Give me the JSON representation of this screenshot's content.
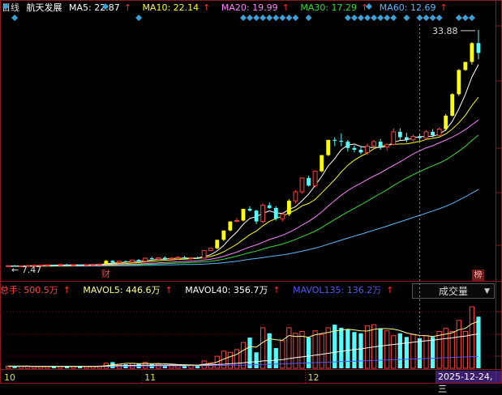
{
  "header": {
    "period": "日线",
    "stock_name": "航天发展",
    "ma": [
      {
        "label": "MA5: 22.87",
        "color": "#ffffff"
      },
      {
        "label": "MA10: 22.14",
        "color": "#ffff00"
      },
      {
        "label": "MA20: 19.99",
        "color": "#ff80ff"
      },
      {
        "label": "MA30: 17.29",
        "color": "#33dd33"
      },
      {
        "label": "MA60: 12.69",
        "color": "#55bbff"
      }
    ],
    "arrow": "↑"
  },
  "volume_header": {
    "total": {
      "label": "总手: 500.5万",
      "color": "#ff4444"
    },
    "mavol": [
      {
        "label": "MAVOL5: 446.6万",
        "color": "#ffff88"
      },
      {
        "label": "MAVOL40: 356.7万",
        "color": "#ffffff"
      },
      {
        "label": "MAVOL135: 136.2万",
        "color": "#5555ff"
      }
    ],
    "arrow": "↑"
  },
  "indicator_select": {
    "value": "成交量"
  },
  "date_badge": "2025-12-24,三",
  "badge_bang": "榜",
  "badge_cai": "财",
  "colors": {
    "up": "#ff4040",
    "down": "#54ffff",
    "limit_up": "#ffff00",
    "diamond": "#3aa0d8"
  },
  "chart_data": {
    "type": "candlestick",
    "price_range": [
      6.5,
      34.5
    ],
    "annotations": {
      "high_label": "33.88",
      "low_label": "7.47"
    },
    "x_axis_labels": [
      {
        "label": "10",
        "index": 0
      },
      {
        "label": "11",
        "index": 21
      },
      {
        "label": "12",
        "index": 46
      }
    ],
    "candles": [
      [
        7.5,
        7.62,
        7.47,
        7.56
      ],
      [
        7.56,
        7.64,
        7.5,
        7.53
      ],
      [
        7.53,
        7.6,
        7.48,
        7.55
      ],
      [
        7.55,
        7.62,
        7.5,
        7.58
      ],
      [
        7.58,
        7.66,
        7.52,
        7.6
      ],
      [
        7.6,
        7.68,
        7.55,
        7.62
      ],
      [
        7.62,
        7.7,
        7.56,
        7.65
      ],
      [
        7.65,
        7.7,
        7.58,
        7.6
      ],
      [
        7.6,
        7.75,
        7.57,
        7.7
      ],
      [
        7.7,
        7.75,
        7.6,
        7.62
      ],
      [
        7.62,
        7.7,
        7.58,
        7.66
      ],
      [
        7.66,
        7.72,
        7.6,
        7.64
      ],
      [
        7.64,
        7.72,
        7.6,
        7.68
      ],
      [
        7.68,
        7.75,
        7.62,
        7.7
      ],
      [
        7.7,
        7.8,
        7.65,
        7.74
      ],
      [
        7.74,
        8.2,
        7.7,
        8.1
      ],
      [
        8.1,
        8.2,
        7.8,
        7.9
      ],
      [
        7.9,
        8.1,
        7.85,
        8.05
      ],
      [
        8.05,
        8.15,
        7.9,
        7.95
      ],
      [
        7.95,
        8.25,
        7.9,
        8.2
      ],
      [
        8.2,
        8.3,
        8.0,
        8.05
      ],
      [
        8.05,
        8.5,
        8.0,
        8.4
      ],
      [
        8.4,
        8.55,
        8.15,
        8.3
      ],
      [
        8.3,
        8.5,
        8.2,
        8.45
      ],
      [
        8.45,
        8.6,
        8.2,
        8.3
      ],
      [
        8.3,
        8.5,
        8.1,
        8.4
      ],
      [
        8.4,
        8.6,
        8.2,
        8.5
      ],
      [
        8.5,
        8.65,
        8.25,
        8.35
      ],
      [
        8.35,
        8.5,
        8.2,
        8.45
      ],
      [
        8.45,
        8.6,
        8.3,
        8.4
      ],
      [
        8.4,
        9.3,
        8.35,
        9.24
      ],
      [
        9.24,
        9.6,
        9.2,
        9.5
      ],
      [
        9.5,
        10.45,
        9.4,
        10.45
      ],
      [
        10.45,
        11.5,
        10.3,
        11.49
      ],
      [
        11.49,
        12.5,
        11.4,
        12.5
      ],
      [
        12.5,
        12.9,
        12.4,
        12.6
      ],
      [
        12.6,
        13.92,
        12.5,
        13.9
      ],
      [
        13.9,
        14.2,
        13.6,
        13.7
      ],
      [
        13.7,
        13.8,
        12.2,
        12.5
      ],
      [
        12.5,
        14.5,
        12.3,
        14.3
      ],
      [
        14.3,
        14.6,
        13.9,
        14.0
      ],
      [
        14.0,
        14.2,
        12.6,
        12.8
      ],
      [
        12.8,
        13.5,
        12.5,
        13.3
      ],
      [
        13.3,
        15.0,
        13.1,
        14.8
      ],
      [
        14.8,
        16.0,
        14.5,
        15.8
      ],
      [
        15.8,
        17.4,
        15.6,
        17.35
      ],
      [
        17.35,
        17.6,
        16.4,
        16.5
      ],
      [
        16.5,
        18.2,
        16.3,
        18.1
      ],
      [
        18.1,
        19.9,
        18.0,
        19.9
      ],
      [
        19.9,
        21.6,
        19.8,
        21.6
      ],
      [
        21.6,
        21.9,
        20.9,
        21.5
      ],
      [
        21.5,
        22.3,
        20.9,
        21.4
      ],
      [
        21.4,
        21.6,
        20.3,
        20.7
      ],
      [
        20.7,
        21.0,
        20.2,
        20.5
      ],
      [
        20.5,
        20.9,
        20.0,
        20.2
      ],
      [
        20.2,
        21.2,
        19.9,
        20.9
      ],
      [
        20.9,
        21.6,
        20.6,
        21.4
      ],
      [
        21.4,
        21.7,
        20.5,
        20.8
      ],
      [
        20.8,
        21.2,
        20.4,
        21.1
      ],
      [
        21.1,
        22.9,
        21.0,
        22.5
      ],
      [
        22.5,
        22.9,
        21.6,
        21.9
      ],
      [
        21.9,
        22.4,
        21.3,
        21.6
      ],
      [
        21.6,
        22.2,
        21.4,
        22.0
      ],
      [
        22.0,
        22.3,
        21.5,
        21.8
      ],
      [
        21.8,
        22.7,
        21.6,
        22.5
      ],
      [
        22.5,
        22.8,
        21.9,
        22.1
      ],
      [
        22.1,
        23.0,
        22.0,
        22.8
      ],
      [
        22.8,
        24.5,
        22.6,
        24.3
      ],
      [
        24.3,
        26.8,
        24.2,
        26.7
      ],
      [
        26.7,
        29.5,
        26.5,
        29.4
      ],
      [
        29.4,
        30.3,
        29.3,
        30.3
      ],
      [
        30.3,
        32.5,
        30.0,
        32.4
      ],
      [
        32.4,
        33.88,
        30.6,
        31.3
      ]
    ],
    "limit_up_days": [
      15,
      32,
      33,
      34,
      36,
      43,
      48,
      49,
      67,
      68,
      69,
      70,
      71
    ],
    "volume_range": [
      0,
      560
    ],
    "volume": [
      18,
      17,
      16,
      18,
      16,
      15,
      16,
      15,
      17,
      15,
      16,
      15,
      16,
      15,
      18,
      42,
      50,
      34,
      32,
      40,
      38,
      48,
      34,
      35,
      26,
      28,
      25,
      29,
      27,
      24,
      60,
      45,
      98,
      140,
      130,
      152,
      210,
      250,
      130,
      330,
      285,
      165,
      225,
      330,
      285,
      300,
      250,
      305,
      275,
      330,
      355,
      330,
      315,
      295,
      285,
      345,
      355,
      325,
      305,
      265,
      285,
      255,
      275,
      245,
      265,
      255,
      300,
      325,
      300,
      390,
      300,
      500,
      420
    ],
    "mavol5": [
      17,
      17,
      17,
      17,
      16,
      16,
      16,
      16,
      16,
      16,
      16,
      16,
      16,
      16,
      16,
      22,
      28,
      32,
      40,
      40,
      38,
      39,
      38,
      39,
      36,
      34,
      30,
      29,
      27,
      26,
      33,
      37,
      51,
      75,
      95,
      113,
      146,
      176,
      172,
      212,
      241,
      232,
      228,
      267,
      258,
      261,
      253,
      273,
      283,
      292,
      303,
      311,
      318,
      312,
      305,
      303,
      317,
      323,
      323,
      319,
      307,
      287,
      277,
      267,
      265,
      259,
      268,
      278,
      289,
      314,
      325,
      363,
      382
    ],
    "mavol40": [
      17,
      17,
      17,
      17,
      16,
      16,
      16,
      16,
      16,
      16,
      16,
      16,
      16,
      16,
      16,
      18,
      20,
      21,
      22,
      23,
      24,
      25,
      25,
      26,
      26,
      26,
      26,
      26,
      26,
      26,
      27,
      27,
      30,
      33,
      37,
      40,
      45,
      51,
      53,
      60,
      62,
      66,
      71,
      79,
      86,
      93,
      99,
      107,
      114,
      122,
      130,
      138,
      145,
      152,
      158,
      166,
      174,
      181,
      188,
      194,
      200,
      206,
      212,
      218,
      224,
      229,
      235,
      242,
      248,
      256,
      262,
      272,
      280
    ],
    "mavol135": [
      15,
      15,
      15,
      15,
      15,
      15,
      15,
      15,
      15,
      15,
      15,
      15,
      15,
      15,
      15,
      16,
      16,
      17,
      17,
      17,
      18,
      18,
      19,
      19,
      19,
      20,
      20,
      20,
      21,
      21,
      21,
      22,
      22,
      23,
      24,
      25,
      26,
      28,
      29,
      31,
      33,
      34,
      36,
      38,
      40,
      42,
      44,
      46,
      48,
      50,
      52,
      54,
      56,
      58,
      60,
      62,
      64,
      66,
      68,
      70,
      72,
      74,
      76,
      78,
      80,
      82,
      84,
      86,
      88,
      90,
      92,
      95,
      97
    ]
  }
}
